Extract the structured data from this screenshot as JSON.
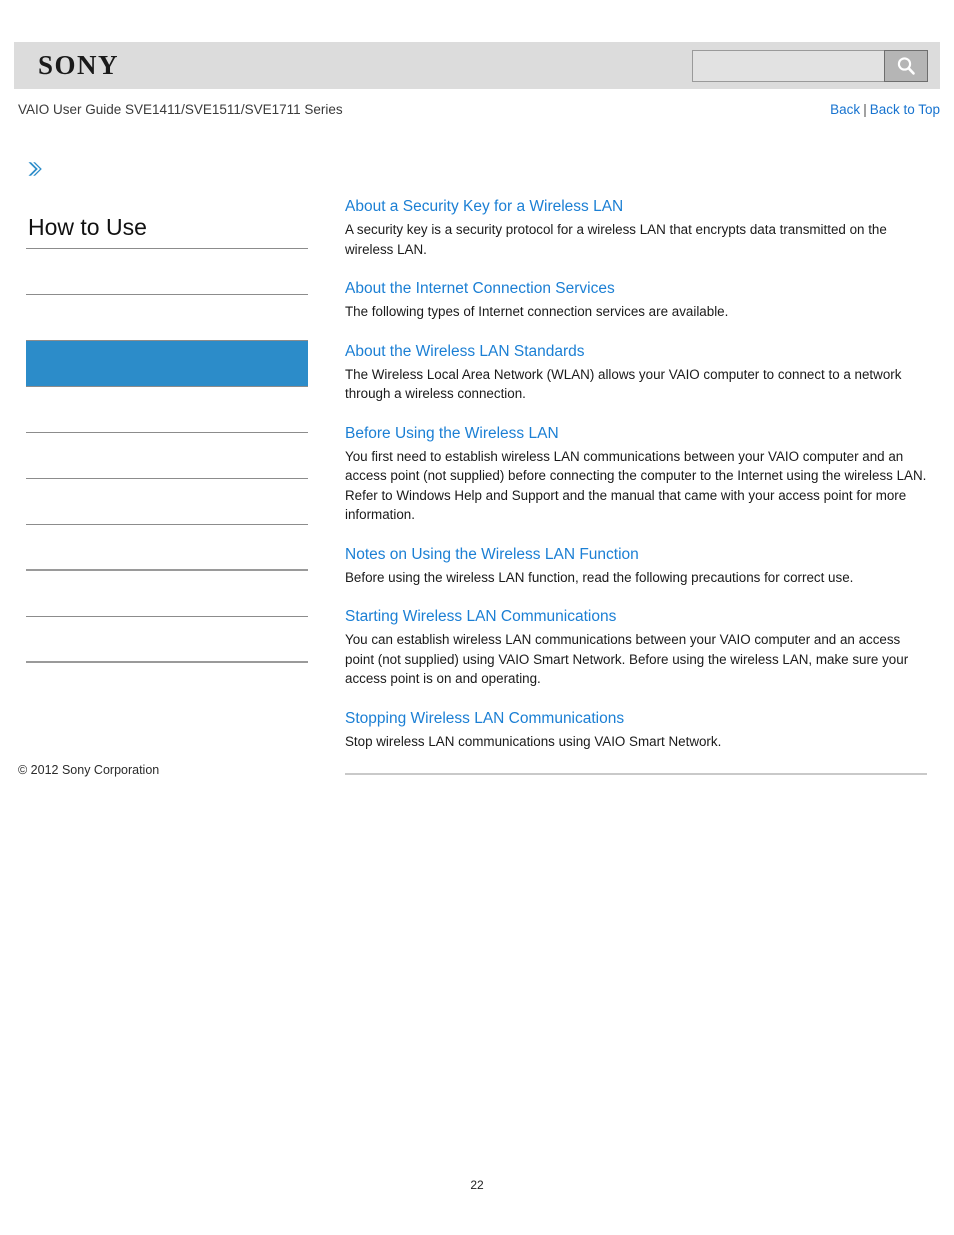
{
  "header": {
    "logo_text": "SONY",
    "logo_icon": "sony-wordmark",
    "guide_title": "VAIO User Guide SVE1411/SVE1511/SVE1711 Series",
    "back_label": "Back",
    "separator": "|",
    "back_to_top_label": "Back to Top",
    "accent_color": "#1773cf",
    "bar_color": "#dcdcdc"
  },
  "search": {
    "value": "",
    "placeholder": "",
    "button_icon": "search-icon",
    "button_label": "Search"
  },
  "sidebar": {
    "breadcrumb_icon": "double-chevron-right-icon",
    "title": "How to Use",
    "selected_color": "#2c8cc9",
    "items": [
      {
        "label": "",
        "selected": false,
        "thick_rule": false
      },
      {
        "label": "",
        "selected": false,
        "thick_rule": false
      },
      {
        "label": "",
        "selected": true,
        "thick_rule": false
      },
      {
        "label": "",
        "selected": false,
        "thick_rule": false
      },
      {
        "label": "",
        "selected": false,
        "thick_rule": false
      },
      {
        "label": "",
        "selected": false,
        "thick_rule": false
      },
      {
        "label": "",
        "selected": false,
        "thick_rule": true
      },
      {
        "label": "",
        "selected": false,
        "thick_rule": false
      },
      {
        "label": "",
        "selected": false,
        "thick_rule": true
      }
    ]
  },
  "content": {
    "entries": [
      {
        "title": "About a Security Key for a Wireless LAN",
        "description": "A security key is a security protocol for a wireless LAN that encrypts data transmitted on the wireless LAN."
      },
      {
        "title": "About the Internet Connection Services",
        "description": "The following types of Internet connection services are available."
      },
      {
        "title": "About the Wireless LAN Standards",
        "description": "The Wireless Local Area Network (WLAN) allows your VAIO computer to connect to a network through a wireless connection."
      },
      {
        "title": "Before Using the Wireless LAN",
        "description": "You first need to establish wireless LAN communications between your VAIO computer and an access point (not supplied) before connecting the computer to the Internet using the wireless LAN. Refer to Windows Help and Support and the manual that came with your access point for more information."
      },
      {
        "title": "Notes on Using the Wireless LAN Function",
        "description": "Before using the wireless LAN function, read the following precautions for correct use."
      },
      {
        "title": "Starting Wireless LAN Communications",
        "description": "You can establish wireless LAN communications between your VAIO computer and an access point (not supplied) using VAIO Smart Network. Before using the wireless LAN, make sure your access point is on and operating."
      },
      {
        "title": "Stopping Wireless LAN Communications",
        "description": "Stop wireless LAN communications using VAIO Smart Network."
      }
    ]
  },
  "footer": {
    "copyright": "© 2012 Sony Corporation",
    "page_number": "22"
  }
}
